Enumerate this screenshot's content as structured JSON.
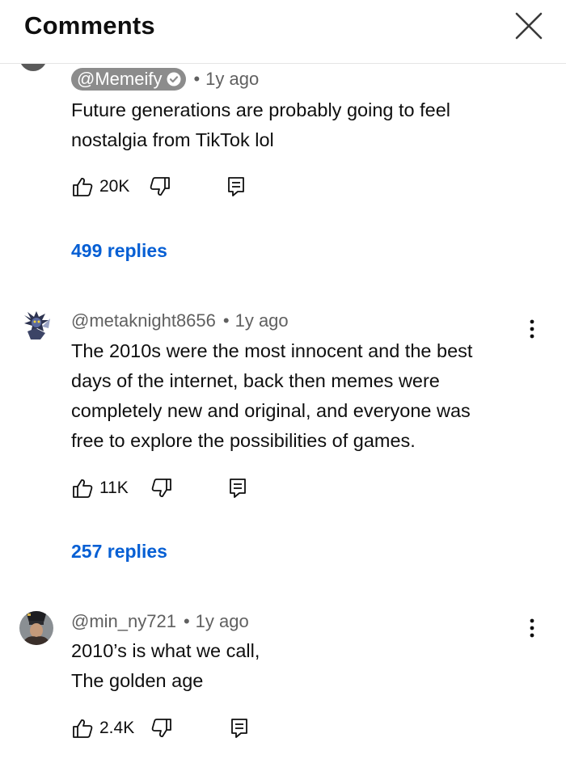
{
  "header": {
    "title": "Comments",
    "close_icon": "close-icon"
  },
  "comments": [
    {
      "author": "@Memeify",
      "verified": true,
      "time": "1y ago",
      "text_lines": [
        "Future generations are probably going to feel",
        "nostalgia from TikTok lol"
      ],
      "likes": "20K",
      "replies": "499 replies"
    },
    {
      "author": "@metaknight8656",
      "verified": false,
      "time": "1y ago",
      "text_lines": [
        "The 2010s were the most innocent and the best",
        "days of the internet, back then memes were",
        "completely new and original, and everyone was",
        "free to explore the possibilities of games."
      ],
      "likes": "11K",
      "replies": "257 replies"
    },
    {
      "author": "@min_ny721",
      "verified": false,
      "time": "1y ago",
      "text_lines": [
        "2010’s is what we call,",
        "The golden age"
      ],
      "likes": "2.4K"
    }
  ],
  "separator": "•",
  "colors": {
    "reply_link": "#065fd4",
    "meta_text": "#606060",
    "author_pill": "#8c8c8c",
    "header_border": "#e5e5e5"
  },
  "icons": [
    "close-icon",
    "thumbs-up-icon",
    "thumbs-down-icon",
    "reply-icon",
    "more-vert-icon",
    "verified-check-icon"
  ]
}
